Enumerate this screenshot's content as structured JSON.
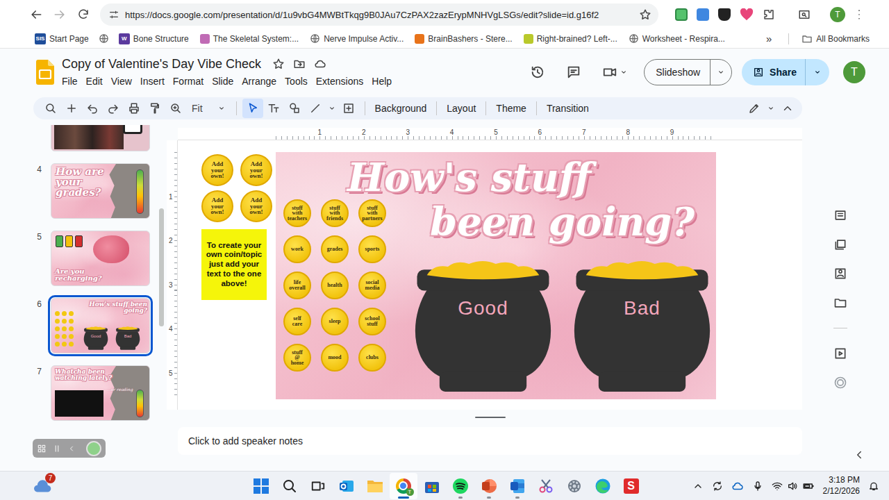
{
  "browser": {
    "url": "https://docs.google.com/presentation/d/1u9vbG4MWBtTkqg9B0JAu7CzPAX2zazErypMNHVgLSGs/edit?slide=id.g16f2",
    "profile": "T",
    "bookmarks": [
      {
        "kind": "link",
        "icon_text": "SIS",
        "color": "#1f4e9a",
        "label": "Start Page"
      },
      {
        "kind": "icon"
      },
      {
        "kind": "link",
        "icon_text": "W",
        "color": "#5b3a9e",
        "label": "Bone Structure"
      },
      {
        "kind": "link",
        "color": "#c06bb5",
        "label": "The Skeletal System:..."
      },
      {
        "kind": "link",
        "label": "Nerve Impulse Activ..."
      },
      {
        "kind": "link",
        "color": "#e8731a",
        "label": "BrainBashers - Stere..."
      },
      {
        "kind": "link",
        "color": "#b9c92b",
        "label": "Right-brained? Left-..."
      },
      {
        "kind": "link",
        "label": "Worksheet - Respira..."
      }
    ],
    "overflow": "»",
    "all_bookmarks": "All Bookmarks"
  },
  "app": {
    "title": "Copy of Valentine's Day Vibe Check",
    "menus": [
      "File",
      "Edit",
      "View",
      "Insert",
      "Format",
      "Slide",
      "Arrange",
      "Tools",
      "Extensions",
      "Help"
    ],
    "slideshow": "Slideshow",
    "share": "Share",
    "avatar": "T"
  },
  "toolbar": {
    "tools": [
      {
        "kind": "search",
        "selected": false
      },
      {
        "kind": "plus",
        "selected": false
      },
      {
        "kind": "undo",
        "selected": false
      },
      {
        "kind": "redo",
        "selected": false
      },
      {
        "kind": "print",
        "selected": false
      },
      {
        "kind": "paint",
        "selected": false
      },
      {
        "kind": "zoom",
        "selected": false
      }
    ],
    "zoom": "Fit",
    "insert_tools": [
      {
        "kind": "cursor",
        "selected": true
      },
      {
        "kind": "textbox",
        "selected": false
      },
      {
        "kind": "shape",
        "selected": false
      },
      {
        "kind": "line",
        "selected": false
      },
      {
        "kind": "caret",
        "selected": false
      },
      {
        "kind": "addbox",
        "selected": false
      }
    ],
    "actions": [
      "Background",
      "Layout",
      "Theme",
      "Transition"
    ]
  },
  "filmstrip": [
    {
      "number": "4",
      "kind": "grades",
      "title": "How are your grades?",
      "selected": false
    },
    {
      "number": "5",
      "kind": "recharge",
      "title": "Are you recharging?",
      "selected": false
    },
    {
      "number": "6",
      "kind": "pots",
      "title": "How's stuff been going?",
      "selected": true
    },
    {
      "number": "7",
      "kind": "watching",
      "title": "Whatcha been watching lately?",
      "subtitle": "...or reading",
      "selected": false
    }
  ],
  "rulers": {
    "horizontal": [
      "1",
      "2",
      "3",
      "4",
      "5",
      "6",
      "7",
      "8",
      "9"
    ],
    "vertical": [
      "1",
      "2",
      "3",
      "4",
      "5"
    ]
  },
  "canvas": {
    "extra_coins": [
      "Add your own!",
      "Add your own!",
      "Add your own!",
      "Add your own!"
    ],
    "note": "To create your own coin/topic just add your text to the one above!"
  },
  "slide": {
    "title_lines": [
      "How's stuff",
      "been going?"
    ],
    "coins": [
      "stuff with teachers",
      "stuff with friends",
      "stuff with partners",
      "work",
      "grades",
      "sports",
      "life overall",
      "health",
      "social media",
      "self care",
      "sleep",
      "school stuff",
      "stuff @ home",
      "mood",
      "clubs"
    ],
    "pots": [
      {
        "label": "Good"
      },
      {
        "label": "Bad"
      }
    ]
  },
  "speaker_notes": {
    "placeholder": "Click to add speaker notes"
  },
  "taskbar": {
    "weather_badge": "7",
    "apps": [
      {
        "kind": "windows",
        "running": false,
        "active": false
      },
      {
        "kind": "search",
        "running": false,
        "active": false
      },
      {
        "kind": "taskview",
        "running": false,
        "active": false
      },
      {
        "kind": "outlook",
        "running": false,
        "active": false
      },
      {
        "kind": "explorer",
        "running": false,
        "active": false
      },
      {
        "kind": "chrome",
        "running": true,
        "active": true,
        "badge": "T"
      },
      {
        "kind": "store",
        "running": false,
        "active": false
      },
      {
        "kind": "spotify",
        "running": true,
        "active": false
      },
      {
        "kind": "powerpoint",
        "running": true,
        "active": false
      },
      {
        "kind": "word",
        "running": true,
        "active": false
      },
      {
        "kind": "snipping",
        "running": false,
        "active": false
      },
      {
        "kind": "settings",
        "running": false,
        "active": false
      },
      {
        "kind": "edge",
        "running": false,
        "active": false
      },
      {
        "kind": "app",
        "running": false,
        "active": false,
        "letter": "S"
      }
    ],
    "time": "3:18 PM",
    "date": "2/12/2026"
  }
}
